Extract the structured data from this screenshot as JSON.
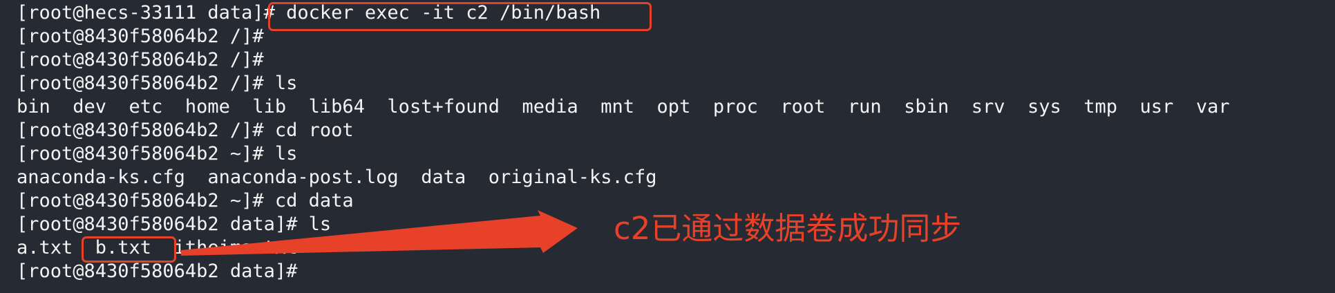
{
  "terminal": {
    "lines": [
      "[root@hecs-33111 data]# docker exec -it c2 /bin/bash",
      "[root@8430f58064b2 /]#",
      "[root@8430f58064b2 /]#",
      "[root@8430f58064b2 /]# ls",
      "bin  dev  etc  home  lib  lib64  lost+found  media  mnt  opt  proc  root  run  sbin  srv  sys  tmp  usr  var",
      "[root@8430f58064b2 /]# cd root",
      "[root@8430f58064b2 ~]# ls",
      "anaconda-ks.cfg  anaconda-post.log  data  original-ks.cfg",
      "[root@8430f58064b2 ~]# cd data",
      "[root@8430f58064b2 data]# ls",
      "a.txt  b.txt  itheima.txt",
      "[root@8430f58064b2 data]#"
    ]
  },
  "annotation": {
    "text": "c2已通过数据卷成功同步",
    "color": "#e8412a"
  },
  "colors": {
    "background": "#262a33",
    "foreground": "#f4f4f4",
    "highlight": "#e8412a"
  }
}
